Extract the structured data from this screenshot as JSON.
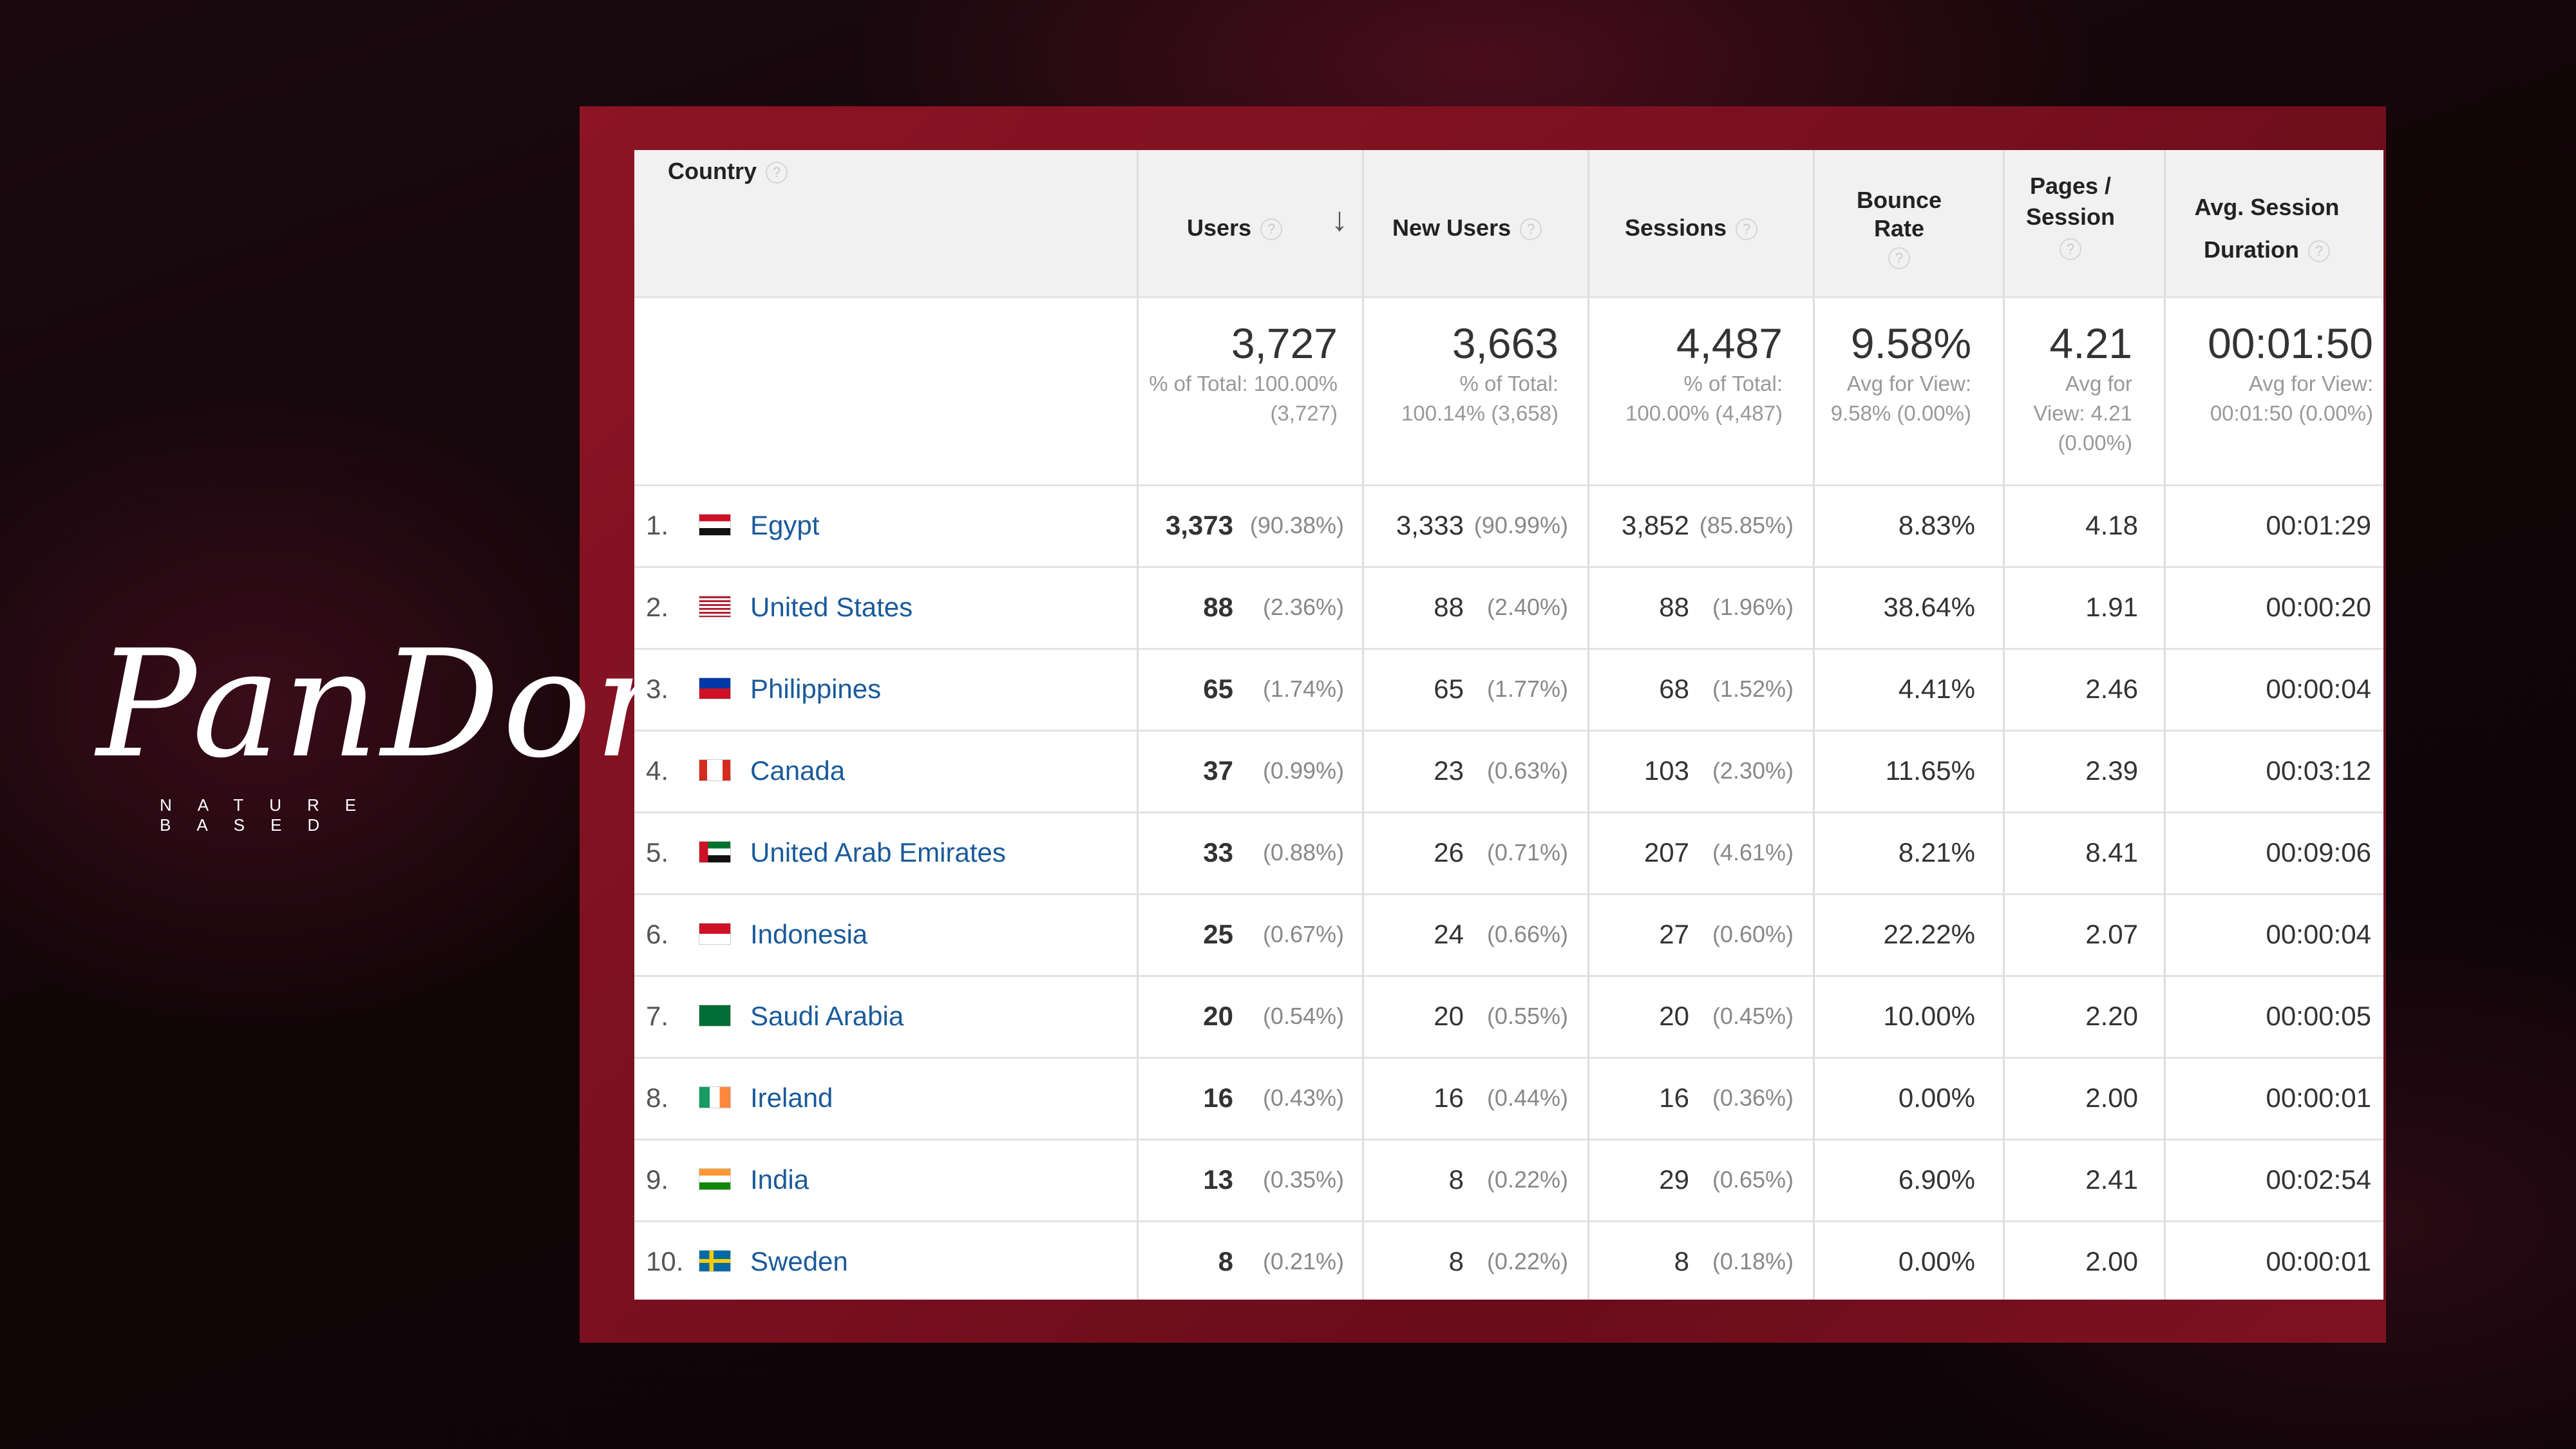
{
  "brand": {
    "name": "PanDora",
    "tagline": "NATURE BASED"
  },
  "headers": {
    "country": "Country",
    "users": "Users",
    "new_users": "New Users",
    "sessions": "Sessions",
    "bounce_rate": "Bounce Rate",
    "pages_line1": "Pages /",
    "pages_line2": "Session",
    "duration_line1": "Avg. Session",
    "duration_line2": "Duration",
    "help_glyph": "?",
    "sort_glyph": "↓"
  },
  "totals": {
    "users": {
      "value": "3,727",
      "sub1": "% of Total: 100.00%",
      "sub2": "(3,727)"
    },
    "new_users": {
      "value": "3,663",
      "sub1": "% of Total:",
      "sub2": "100.14% (3,658)"
    },
    "sessions": {
      "value": "4,487",
      "sub1": "% of Total:",
      "sub2": "100.00% (4,487)"
    },
    "bounce_rate": {
      "value": "9.58%",
      "sub1": "Avg for View:",
      "sub2": "9.58% (0.00%)"
    },
    "pages": {
      "value": "4.21",
      "sub1": "Avg for",
      "sub2": "View: 4.21",
      "sub3": "(0.00%)"
    },
    "duration": {
      "value": "00:01:50",
      "sub1": "Avg for View:",
      "sub2": "00:01:50 (0.00%)"
    }
  },
  "rows": [
    {
      "rank": "1.",
      "country": "Egypt",
      "flag": "egypt",
      "users": "3,373",
      "users_pct": "(90.38%)",
      "new_users": "3,333",
      "new_users_pct": "(90.99%)",
      "sessions": "3,852",
      "sessions_pct": "(85.85%)",
      "bounce": "8.83%",
      "pages": "4.18",
      "duration": "00:01:29"
    },
    {
      "rank": "2.",
      "country": "United States",
      "flag": "us",
      "users": "88",
      "users_pct": "(2.36%)",
      "new_users": "88",
      "new_users_pct": "(2.40%)",
      "sessions": "88",
      "sessions_pct": "(1.96%)",
      "bounce": "38.64%",
      "pages": "1.91",
      "duration": "00:00:20"
    },
    {
      "rank": "3.",
      "country": "Philippines",
      "flag": "ph",
      "users": "65",
      "users_pct": "(1.74%)",
      "new_users": "65",
      "new_users_pct": "(1.77%)",
      "sessions": "68",
      "sessions_pct": "(1.52%)",
      "bounce": "4.41%",
      "pages": "2.46",
      "duration": "00:00:04"
    },
    {
      "rank": "4.",
      "country": "Canada",
      "flag": "ca",
      "users": "37",
      "users_pct": "(0.99%)",
      "new_users": "23",
      "new_users_pct": "(0.63%)",
      "sessions": "103",
      "sessions_pct": "(2.30%)",
      "bounce": "11.65%",
      "pages": "2.39",
      "duration": "00:03:12"
    },
    {
      "rank": "5.",
      "country": "United Arab Emirates",
      "flag": "uae",
      "users": "33",
      "users_pct": "(0.88%)",
      "new_users": "26",
      "new_users_pct": "(0.71%)",
      "sessions": "207",
      "sessions_pct": "(4.61%)",
      "bounce": "8.21%",
      "pages": "8.41",
      "duration": "00:09:06"
    },
    {
      "rank": "6.",
      "country": "Indonesia",
      "flag": "id",
      "users": "25",
      "users_pct": "(0.67%)",
      "new_users": "24",
      "new_users_pct": "(0.66%)",
      "sessions": "27",
      "sessions_pct": "(0.60%)",
      "bounce": "22.22%",
      "pages": "2.07",
      "duration": "00:00:04"
    },
    {
      "rank": "7.",
      "country": "Saudi Arabia",
      "flag": "sa",
      "users": "20",
      "users_pct": "(0.54%)",
      "new_users": "20",
      "new_users_pct": "(0.55%)",
      "sessions": "20",
      "sessions_pct": "(0.45%)",
      "bounce": "10.00%",
      "pages": "2.20",
      "duration": "00:00:05"
    },
    {
      "rank": "8.",
      "country": "Ireland",
      "flag": "ie",
      "users": "16",
      "users_pct": "(0.43%)",
      "new_users": "16",
      "new_users_pct": "(0.44%)",
      "sessions": "16",
      "sessions_pct": "(0.36%)",
      "bounce": "0.00%",
      "pages": "2.00",
      "duration": "00:00:01"
    },
    {
      "rank": "9.",
      "country": "India",
      "flag": "in",
      "users": "13",
      "users_pct": "(0.35%)",
      "new_users": "8",
      "new_users_pct": "(0.22%)",
      "sessions": "29",
      "sessions_pct": "(0.65%)",
      "bounce": "6.90%",
      "pages": "2.41",
      "duration": "00:02:54"
    },
    {
      "rank": "10.",
      "country": "Sweden",
      "flag": "se",
      "users": "8",
      "users_pct": "(0.21%)",
      "new_users": "8",
      "new_users_pct": "(0.22%)",
      "sessions": "8",
      "sessions_pct": "(0.18%)",
      "bounce": "0.00%",
      "pages": "2.00",
      "duration": "00:00:01"
    }
  ],
  "colors": {
    "link": "#1a5a9a",
    "frame": "#7a1020",
    "header_bg": "#f1f1f1"
  }
}
